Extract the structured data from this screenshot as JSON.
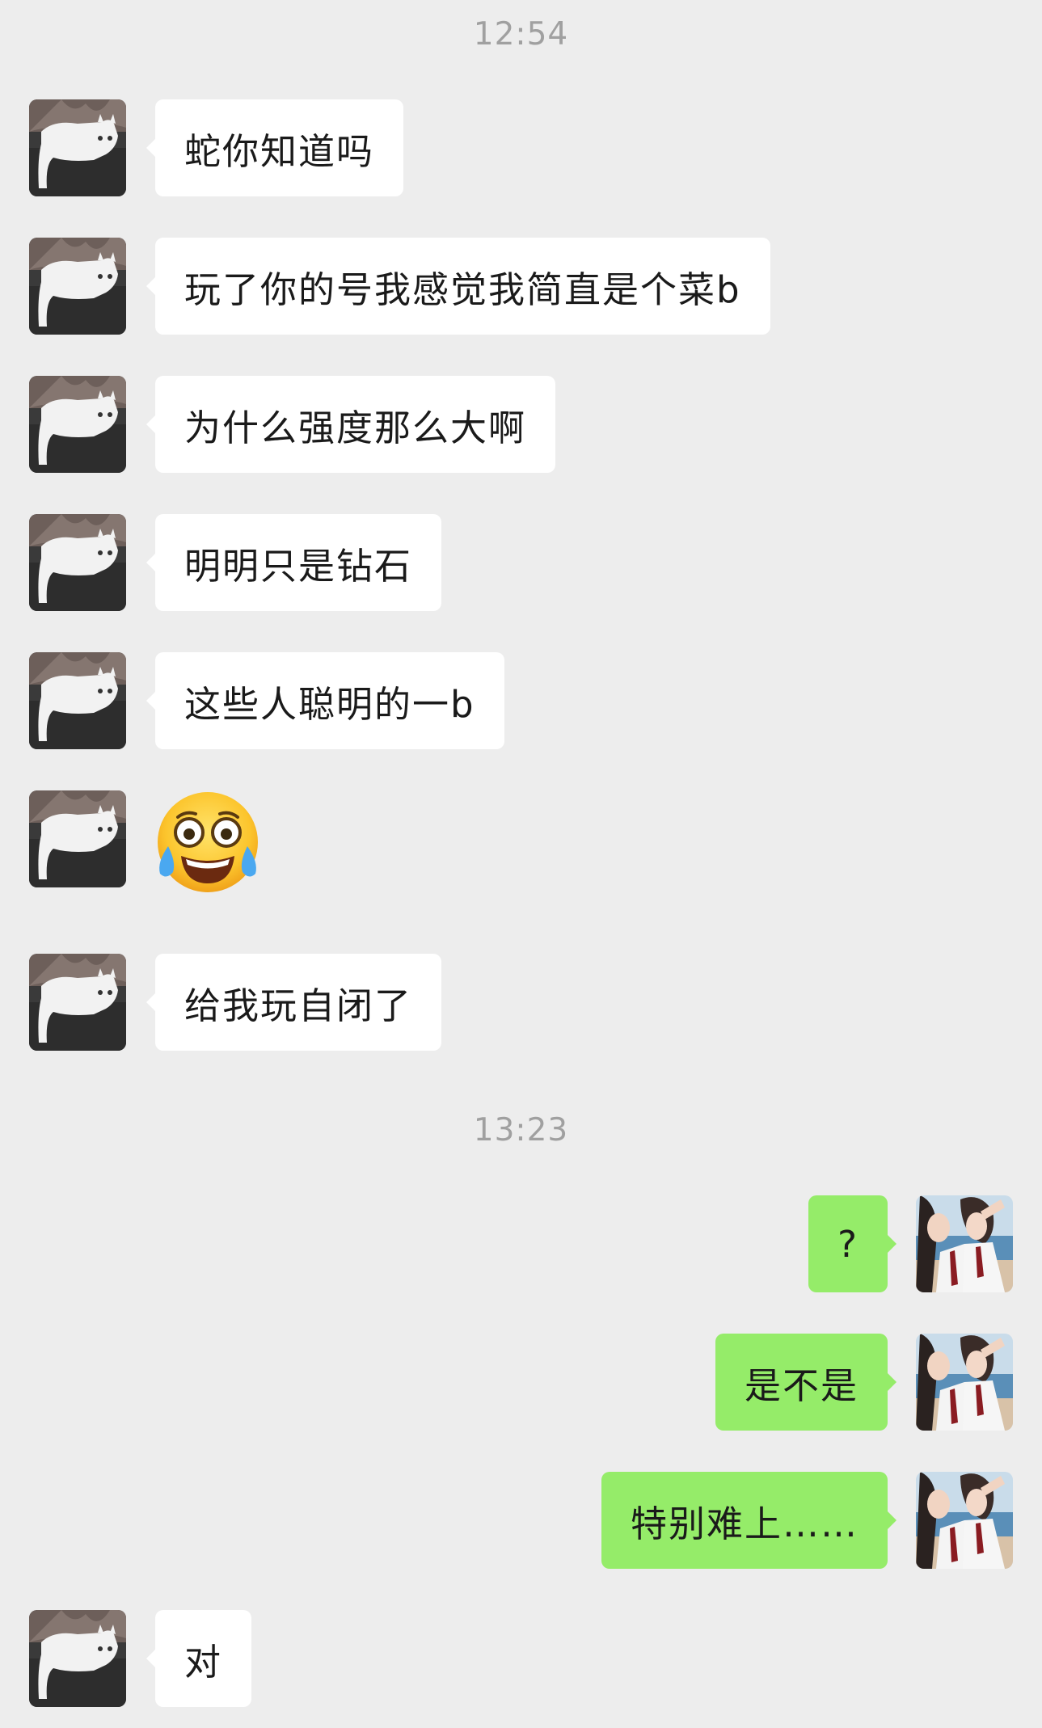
{
  "timestamps": [
    "12:54",
    "13:23"
  ],
  "messages": [
    {
      "side": "left",
      "kind": "text",
      "text": "蛇你知道吗"
    },
    {
      "side": "left",
      "kind": "text",
      "text": "玩了你的号我感觉我简直是个菜b"
    },
    {
      "side": "left",
      "kind": "text",
      "text": "为什么强度那么大啊"
    },
    {
      "side": "left",
      "kind": "text",
      "text": "明明只是钻石"
    },
    {
      "side": "left",
      "kind": "text",
      "text": "这些人聪明的一b"
    },
    {
      "side": "left",
      "kind": "emoji",
      "icon": "face-with-tears-of-joy-emoji"
    },
    {
      "side": "left",
      "kind": "text",
      "text": "给我玩自闭了"
    },
    {
      "side": "right",
      "kind": "text",
      "text": "?"
    },
    {
      "side": "right",
      "kind": "text",
      "text": "是不是"
    },
    {
      "side": "right",
      "kind": "text",
      "text": "特别难上……"
    },
    {
      "side": "left",
      "kind": "text",
      "text": "对"
    }
  ],
  "avatars": {
    "contact": "white-cat-avatar",
    "self": "girl-seaside-avatar"
  },
  "colors": {
    "background": "#ededed",
    "incoming_bubble": "#ffffff",
    "outgoing_bubble": "#95ec69",
    "timestamp_text": "#a0a0a0"
  }
}
